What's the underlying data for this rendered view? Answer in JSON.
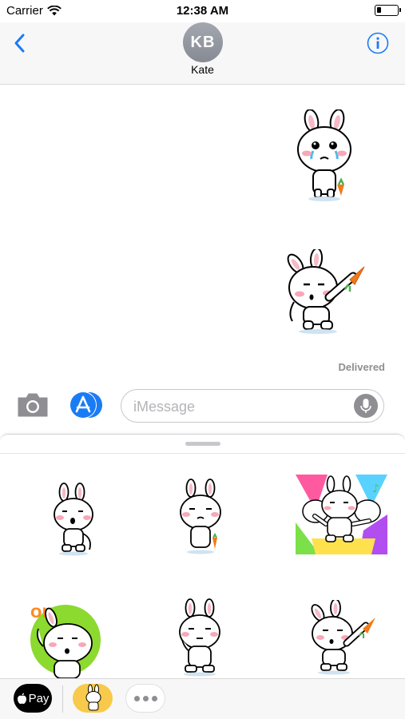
{
  "status_bar": {
    "carrier": "Carrier",
    "time": "12:38 AM"
  },
  "header": {
    "avatar_initials": "KB",
    "contact_name": "Kate"
  },
  "conversation": {
    "status": "Delivered"
  },
  "compose": {
    "placeholder": "iMessage"
  },
  "app_strip": {
    "applepay_label": "Pay"
  },
  "icons": {
    "back": "chevron-left-icon",
    "info": "info-icon",
    "camera": "camera-icon",
    "appstore": "app-store-icon",
    "mic": "microphone-icon",
    "apple": "apple-logo-icon",
    "more": "ellipsis-icon"
  },
  "colors": {
    "accent": "#1a7cf5",
    "muted": "#8e8e93",
    "sticker_app": "#f8c94a",
    "carrot": "#f07a1a"
  }
}
